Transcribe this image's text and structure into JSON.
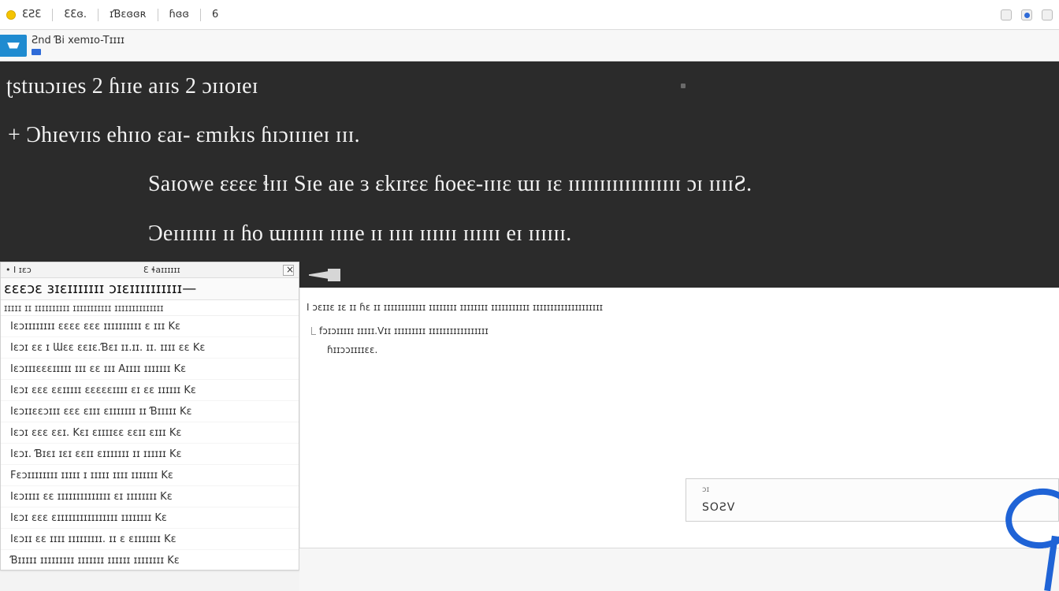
{
  "topbar": {
    "item1": "ƐƧƐ",
    "item2": "ƐƐɞ.",
    "item3": "ɪƁɛɞɞʀ",
    "item4": "ɦɞɞ",
    "item5": "6"
  },
  "header": {
    "title": "Ƨnd Ɓi xemɪo-Tɪɪɪɪ",
    "subtitle": ""
  },
  "hero": {
    "line1": "ʈstɪuɔɪɪes 2 ɦɪɪe aɪɪs 2 ɔɪɪoɪeɪ",
    "line2": "+ Ɔhɪevɪɪs ehɪɪo ɛaɪ- ɛmɪkɪs ɦɪɔɪɪɪɪeɪ ɪɪɪ.",
    "line3": "Saɪowe ɛɛɛɛ ɬɪɪɪ Sɪe aɪe ɜ ɛkɪrɛɛ ɦoeɛ-ɪɪɪɛ ɯɪ ɪɛ ɪɪɪɪɪɪɪɪɪɪɪɪɪɪɪɪɪɪ ɔɪ ɪɪɪɪƧ.",
    "line4": "Ɔeɪɪɪɪɪɪɪ ɪɪ ɦo ɯɪɪɪɪɪɪ ɪɪɪɪe ɪɪ ɪɪɪɪ ɪɪɪɪɪɪ ɪɪɪɪɪɪ eɪ ɪɪɪɪɪɪ."
  },
  "leftpanel": {
    "toplabel_left": "• I ɪɛɔ",
    "toplabel_right": "Ɛ ɬaɪɪɪɪɪɪ",
    "search_text": "ɛɛɛɔɛ ɜɪɛɪɪɪɪɪɪɪ ɔɪɛɪɪɪɪɪɪɪɪɪɪ—",
    "subheader": "ɪɪɪɪɪ ɪɪ ɪɪɪɪɪɪɪɪɪɪ ɪɪɪɪɪɪɪɪɪɪɪ ɪɪɪɪɪɪɪɪɪɪɪɪɪɪ",
    "rows": [
      "Iɛɔɪɪɪɪɪɪɪɪ ɛɛɛɛ ɛɛɛ ɪɪɪɪɪɪɪɪɪɪ ɛ ɪɪɪ Kɛ",
      "Iɛɔɪ ɛɛ ɪ Ɯɛɛ ɛɛɪɛ.Ɓɛɪ ɪɪ.ɪɪ. ɪɪ. ɪɪɪɪ ɛɛ Kɛ",
      "Iɛɔɪɪɪɛɛɛɪɪɪɪɪ ɪɪɪ ɛɛ ɪɪɪ Aɪɪɪɪ ɪɪɪɪɪɪɪ Kɛ",
      "Iɛɔɪ ɛɛɛ ɛɛɪɪɪɪɪ ɛɛɛɛɛɪɪɪɪ ɛɪ ɛɛ ɪɪɪɪɪɪ Kɛ",
      "Iɛɔɪɪɛɛɔɪɪɪ ɛɛɛ ɛɪɪɪ ɛɪɪɪɪɪɪɪ ɪɪ Ɓɪɪɪɪɪ Kɛ",
      "Iɛɔɪ ɛɛɛ ɛɛɪ. Kɛɪ ɛɪɪɪɪɛɛ ɛɛɪɪ ɛɪɪɪ Kɛ",
      "Iɛɔɪ. Ɓɪɛɪ ɪɛɪ ɛɛɪɪ ɛɪɪɪɪɪɪɪ ɪɪ ɪɪɪɪɪɪ Kɛ",
      "Fɛɔɪɪɪɪɪɪɪɪ ɪɪɪɪɪ ɪ ɪɪɪɪɪ ɪɪɪɪ ɪɪɪɪɪɪɪ Kɛ",
      "Iɛɔɪɪɪɪ ɛɛ ɪɪɪɪɪɪɪɪɪɪɪɪɪɪ ɛɪ ɪɪɪɪɪɪɪɪ Kɛ",
      "Iɛɔɪ ɛɛɛ ɛɪɪɪɪɪɪɪɪɪɪɪɪɪɪɪɪ ɪɪɪɪɪɪɪɪ Kɛ",
      "Iɛɔɪɪ ɛɛ ɪɪɪɪ ɪɪɪɪɪɪɪɪɪ. ɪɪ ɛ ɛɪɪɪɪɪɪɪ Kɛ",
      "Ɓɪɪɪɪɪ ɪɪɪɪɪɪɪɪɪ ɪɪɪɪɪɪɪ ɪɪɪɪɪɪ ɪɪɪɪɪɪɪɪ Kɛ"
    ]
  },
  "content": {
    "line1": "I ɔɛɪɪɛ ɪɛ ɪɪ ɦɛ ɪɪ ɪɪɪɪɪɪɪɪɪɪɪɪ ɪɪɪɪɪɪɪɪ ɪɪɪɪɪɪɪɪ ɪɪɪɪɪɪɪɪɪɪɪ ɪɪɪɪɪɪɪɪɪɪɪɪɪɪɪɪɪɪɪɪ",
    "line2": "fɔɪɔɪɪɪɪɪ ɪɪɪɪɪ.Vɪɪ ɪɪɪɪɪɪɪɪɪ ɪɪɪɪɪɪɪɪɪɪɪɪɪɪɪɪɪ",
    "line3": "ɦɪɪɔɔɪɪɪɪɛɛ."
  },
  "savebox": {
    "small": "ɔɪ",
    "label": "SOƧV"
  },
  "colors": {
    "hero_bg": "#2b2b2b",
    "accent_blue": "#1f63d6",
    "logo_blue": "#1f8bd0",
    "dot_yellow": "#f5c400"
  },
  "icons": {
    "topbar_left_dot": "status-dot",
    "top_right_1": "window-icon",
    "top_right_2": "window-icon",
    "top_right_3": "window-icon",
    "logo": "app-logo",
    "panel_close": "close-icon",
    "hero_arrow": "arrow-icon",
    "hero_horn": "horn-icon",
    "cursor": "cursor-icon"
  }
}
